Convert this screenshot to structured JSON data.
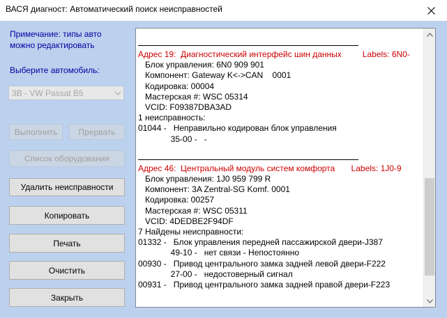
{
  "window": {
    "title": "ВАСЯ диагност: Автоматический поиск неисправностей"
  },
  "note": {
    "line1": "Примечание: типы авто",
    "line2": "можно редактировать"
  },
  "vehicle": {
    "label": "Выберите автомобиль:",
    "selected": "3B - VW Passat B5"
  },
  "buttons": {
    "execute": "Выполнить",
    "abort": "Прервать",
    "equipment_list": "Список оборудования",
    "delete_faults": "Удалить неисправности",
    "copy": "Копировать",
    "print": "Печать",
    "clear": "Очистить",
    "close": "Закрыть"
  },
  "report": {
    "lines": [
      {
        "type": "sep",
        "text": ""
      },
      {
        "type": "hdr",
        "text": "Адрес 19:  Диагностический интерфейс шин данных         Labels: 6N0-"
      },
      {
        "type": "txt",
        "text": "   Блок управления: 6N0 909 901"
      },
      {
        "type": "txt",
        "text": "   Компонент: Gateway K<->CAN    0001"
      },
      {
        "type": "txt",
        "text": "   Кодировка: 00004"
      },
      {
        "type": "txt",
        "text": "   Мастерская #: WSC 05314"
      },
      {
        "type": "txt",
        "text": "   VCID: F09387DBA3AD"
      },
      {
        "type": "txt",
        "text": "1 неисправность:"
      },
      {
        "type": "txt",
        "text": "01044 -   Неправильно кодирован блок управления"
      },
      {
        "type": "txt",
        "text": "              35-00 -   -"
      },
      {
        "type": "txt",
        "text": ""
      },
      {
        "type": "sep",
        "text": ""
      },
      {
        "type": "hdr",
        "text": "Адрес 46:  Центральный модуль систем комфорта       Labels: 1J0-9"
      },
      {
        "type": "txt",
        "text": "   Блок управления: 1J0 959 799 R"
      },
      {
        "type": "txt",
        "text": "   Компонент: 3A Zentral-SG Komf. 0001"
      },
      {
        "type": "txt",
        "text": "   Кодировка: 00257"
      },
      {
        "type": "txt",
        "text": "   Мастерская #: WSC 05311"
      },
      {
        "type": "txt",
        "text": "   VCID: 4DEDBE2F94DF"
      },
      {
        "type": "txt",
        "text": "7 Найдены неисправности:"
      },
      {
        "type": "txt",
        "text": "01332 -   Блок управления передней пассажирской двери-J387"
      },
      {
        "type": "txt",
        "text": "              49-10 -   нет связи - Непостоянно"
      },
      {
        "type": "txt",
        "text": "00930 -   Привод центрального замка задней левой двери-F222"
      },
      {
        "type": "txt",
        "text": "              27-00 -   недостоверный сигнал"
      },
      {
        "type": "txt",
        "text": "00931 -   Привод центрального замка задней правой двери-F223"
      }
    ]
  }
}
